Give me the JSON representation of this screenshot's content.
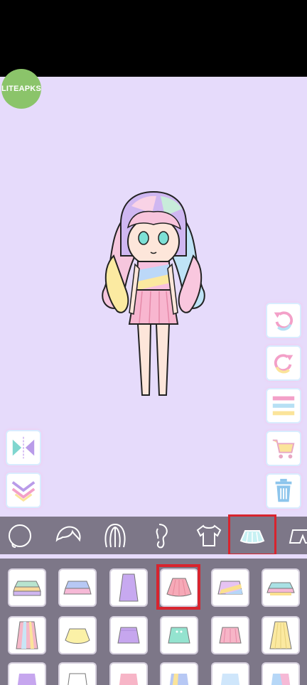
{
  "app": {
    "watermark": "LITEAPKS"
  },
  "side_buttons": [
    {
      "name": "undo-button",
      "icon": "undo-arrow-icon"
    },
    {
      "name": "redo-button",
      "icon": "redo-arrow-icon"
    },
    {
      "name": "layers-button",
      "icon": "layers-icon"
    },
    {
      "name": "shop-button",
      "icon": "shopping-cart-icon"
    },
    {
      "name": "delete-button",
      "icon": "trash-icon"
    },
    {
      "name": "flip-button",
      "icon": "flip-icon"
    },
    {
      "name": "hide-panel-button",
      "icon": "chevron-down-icon"
    }
  ],
  "categories": [
    {
      "name": "face",
      "icon": "face-outline-icon"
    },
    {
      "name": "bangs",
      "icon": "bangs-icon"
    },
    {
      "name": "hair",
      "icon": "hair-icon"
    },
    {
      "name": "side-hair",
      "icon": "side-hair-icon"
    },
    {
      "name": "tops",
      "icon": "tshirt-icon"
    },
    {
      "name": "skirts",
      "icon": "skirt-icon",
      "selected": true
    },
    {
      "name": "pants",
      "icon": "shorts-icon"
    }
  ],
  "colors": {
    "stage_bg": "#e6dbfb",
    "panel_bg": "#7d7788",
    "highlight": "#d8242e",
    "logo": "#8bc46a"
  },
  "skirt_items": [
    {
      "colors": [
        "#b8e4cf",
        "#f9d99a",
        "#cfb6f0"
      ],
      "style": "ruffle"
    },
    {
      "colors": [
        "#b7c8f4",
        "#f6b9d6"
      ],
      "style": "ruffle"
    },
    {
      "colors": [
        "#c7a9f0"
      ],
      "style": "long"
    },
    {
      "colors": [
        "#f6a9b7"
      ],
      "style": "flare",
      "selected": true
    },
    {
      "colors": [
        "#e6c3f2",
        "#fbe08d",
        "#b6d7f7"
      ],
      "style": "stripe"
    },
    {
      "colors": [
        "#a9e1e4",
        "#f6b9d6",
        "#fbe08d"
      ],
      "style": "ruffle"
    },
    {
      "colors": [
        "#f5b8c8",
        "#c8e6f6",
        "#fbe49a"
      ],
      "style": "long-stripe"
    },
    {
      "colors": [
        "#fbf1a7"
      ],
      "style": "bubble"
    },
    {
      "colors": [
        "#c6a6ee"
      ],
      "style": "wrap"
    },
    {
      "colors": [
        "#94e3cf"
      ],
      "style": "button"
    },
    {
      "colors": [
        "#f7b5c7"
      ],
      "style": "pleated"
    },
    {
      "colors": [
        "#fbe9a0"
      ],
      "style": "long-pleated"
    }
  ]
}
